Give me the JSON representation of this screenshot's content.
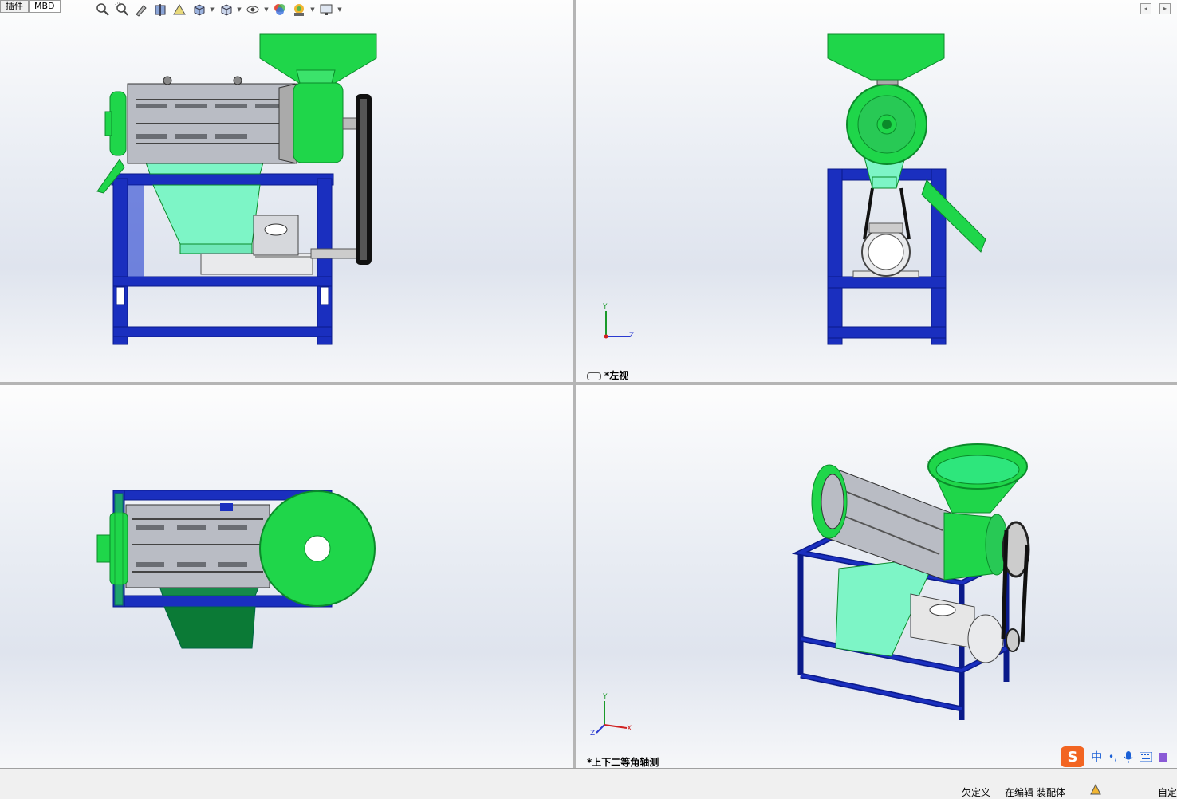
{
  "tabs": [
    {
      "label": "插件"
    },
    {
      "label": "MBD"
    }
  ],
  "hud_icons": [
    "zoom-to-fit-icon",
    "zoom-area-icon",
    "previous-view-icon",
    "section-view-icon",
    "dynamic-annotation-icon",
    "view-orientation-icon",
    "display-style-icon",
    "hide-show-icon",
    "edit-appearance-icon",
    "apply-scene-icon",
    "view-settings-icon"
  ],
  "viewports": {
    "top_left": {
      "label": ""
    },
    "top_right": {
      "label": "*左视"
    },
    "bottom_left": {
      "label": ""
    },
    "bottom_right": {
      "label": "*上下二等角轴测"
    }
  },
  "triad": {
    "x": "X",
    "y": "Y",
    "z": "Z"
  },
  "status": {
    "underdefined": "欠定义",
    "editing_label": "在编辑",
    "editing_value": "装配体",
    "custom": "自定"
  },
  "ime": {
    "logo": "S",
    "mode": "中"
  },
  "colors": {
    "frame": "#1a2fbf",
    "frame_dark": "#0a1a8a",
    "green": "#1fd64a",
    "green_dark": "#0b8a2a",
    "mint": "#7df5c6",
    "drum": "#b9bcc4"
  }
}
